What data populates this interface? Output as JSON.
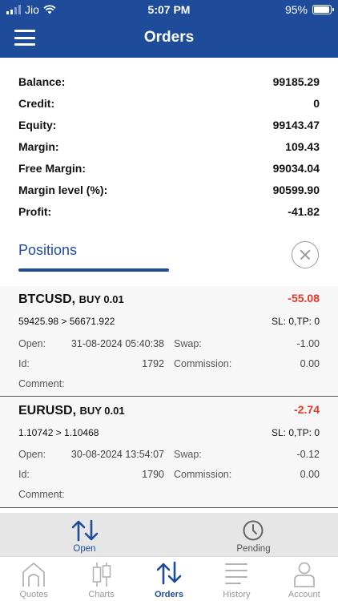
{
  "status_bar": {
    "carrier": "Jio",
    "time": "5:07 PM",
    "battery": "95%",
    "battery_level": 0.95
  },
  "nav": {
    "title": "Orders"
  },
  "summary": [
    {
      "label": "Balance:",
      "value": "99185.29"
    },
    {
      "label": "Credit:",
      "value": "0"
    },
    {
      "label": "Equity:",
      "value": "99143.47"
    },
    {
      "label": "Margin:",
      "value": "109.43"
    },
    {
      "label": "Free Margin:",
      "value": "99034.04"
    },
    {
      "label": "Margin level (%):",
      "value": "90599.90"
    },
    {
      "label": "Profit:",
      "value": "-41.82"
    }
  ],
  "positions": {
    "title": "Positions",
    "items": [
      {
        "symbol": "BTCUSD,",
        "side": "BUY 0.01",
        "pnl": "-55.08",
        "prices": "59425.98 > 56671.922",
        "sltp": "SL: 0,TP: 0",
        "open_label": "Open:",
        "open_value": "31-08-2024 05:40:38",
        "swap_label": "Swap:",
        "swap_value": "-1.00",
        "id_label": "Id:",
        "id_value": "1792",
        "commission_label": "Commission:",
        "commission_value": "0.00",
        "comment_label": "Comment:"
      },
      {
        "symbol": "EURUSD,",
        "side": "BUY 0.01",
        "pnl": "-2.74",
        "prices": "1.10742 > 1.10468",
        "sltp": "SL: 0,TP: 0",
        "open_label": "Open:",
        "open_value": "30-08-2024 13:54:07",
        "swap_label": "Swap:",
        "swap_value": "-0.12",
        "id_label": "Id:",
        "id_value": "1790",
        "commission_label": "Commission:",
        "commission_value": "0.00",
        "comment_label": "Comment:"
      }
    ]
  },
  "subtabs": {
    "open": "Open",
    "pending": "Pending"
  },
  "tabbar": {
    "quotes": "Quotes",
    "charts": "Charts",
    "orders": "Orders",
    "history": "History",
    "account": "Account"
  },
  "colors": {
    "brand": "#1f4c9a",
    "negative": "#e0392a",
    "inactive": "#999999"
  }
}
